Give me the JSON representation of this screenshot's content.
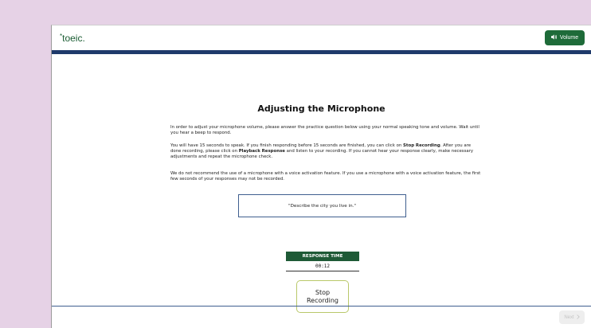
{
  "header": {
    "logo_text": "toeic",
    "logo_star": "*",
    "logo_dot": ".",
    "volume_label": "Volume",
    "volume_icon": "speaker-icon"
  },
  "main": {
    "title": "Adjusting the Microphone",
    "p1": "In order to adjust your microphone volume, please answer the practice question below using your normal speaking tone and volume. Wait until you hear a beep to respond.",
    "p2_a": "You will have 15 seconds to speak. If you finish responding before 15 seconds are finished, you can click on ",
    "p2_b": "Stop Recording",
    "p2_c": ". After you are done recording, please click on ",
    "p2_d": "Playback Response",
    "p2_e": " and listen to your recording. If you cannot hear your response clearly, make necessary adjustments and repeat the microphone check.",
    "p3": "We do not recommend the use of a microphone with a voice activation feature. If you use a microphone with a voice activation feature, the first few seconds of your responses may not be recorded.",
    "question": "\"Describe the city you live in.\"",
    "response_time_label": "RESPONSE TIME",
    "response_time_value": "00:12",
    "stop_recording_label": "Stop Recording"
  },
  "footer": {
    "next_label": "Next",
    "next_icon": "chevron-right-icon"
  },
  "colors": {
    "brand_green": "#1e6b39",
    "header_bar": "#1f3a6b",
    "background": "#e6d2e6"
  }
}
